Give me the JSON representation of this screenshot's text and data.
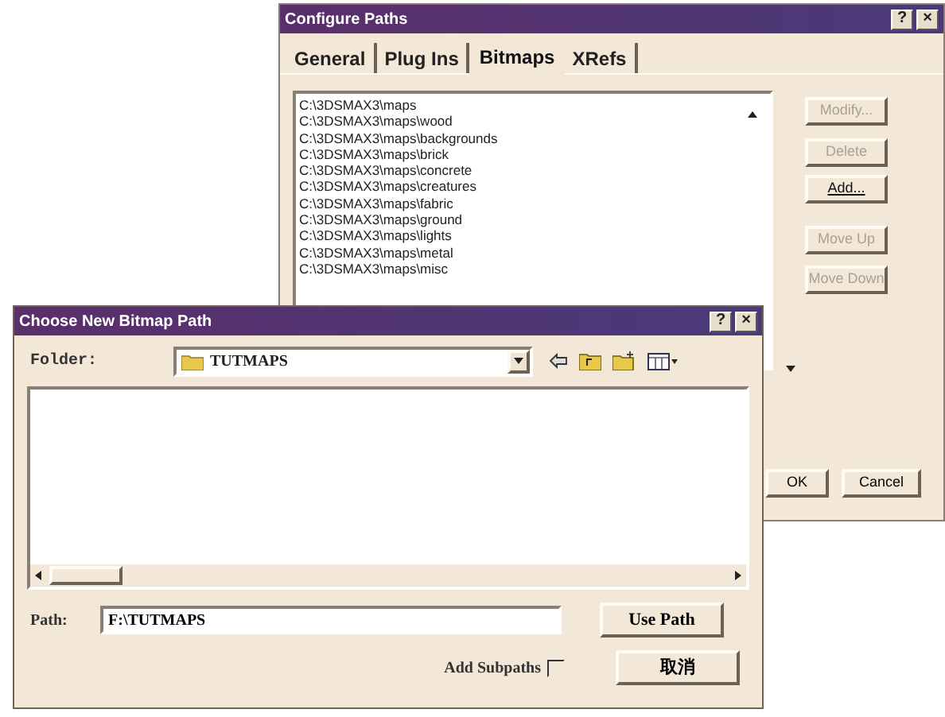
{
  "configure_paths": {
    "title": "Configure Paths",
    "title_buttons": [
      "?",
      "×"
    ],
    "tabs": [
      {
        "label": "General",
        "selected": false
      },
      {
        "label": "Plug Ins",
        "selected": false
      },
      {
        "label": "Bitmaps",
        "selected": true
      },
      {
        "label": "XRefs",
        "selected": false
      }
    ],
    "paths": [
      "C:\\3DSMAX3\\maps",
      "C:\\3DSMAX3\\maps\\wood",
      "C:\\3DSMAX3\\maps\\backgrounds",
      "C:\\3DSMAX3\\maps\\brick",
      "C:\\3DSMAX3\\maps\\concrete",
      "C:\\3DSMAX3\\maps\\creatures",
      "C:\\3DSMAX3\\maps\\fabric",
      "C:\\3DSMAX3\\maps\\ground",
      "C:\\3DSMAX3\\maps\\lights",
      "C:\\3DSMAX3\\maps\\metal",
      "C:\\3DSMAX3\\maps\\misc"
    ],
    "buttons": [
      {
        "label": "Modify...",
        "disabled": true
      },
      {
        "label": "Delete",
        "disabled": true
      },
      {
        "label": "Add...",
        "disabled": false
      },
      {
        "label": "Move Up",
        "disabled": true
      },
      {
        "label": "Move Down",
        "disabled": true
      }
    ],
    "ok": "OK",
    "cancel": "Cancel"
  },
  "choose_bitmap_path": {
    "title": "Choose New Bitmap Path",
    "title_buttons": [
      "?",
      "×"
    ],
    "folder_label": "Folder:",
    "folder": "TUTMAPS",
    "path_label": "Path:",
    "path": "F:\\TUTMAPS",
    "use_path": "Use Path",
    "add_subpaths": {
      "label": "Add Subpaths",
      "checked": false
    },
    "cancel": "取消"
  }
}
